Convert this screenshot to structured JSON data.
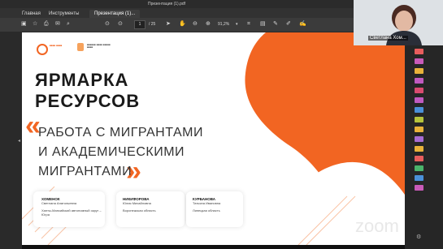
{
  "window": {
    "title": "Презентация (1).pdf"
  },
  "tabs": [
    {
      "label": "Главная"
    },
    {
      "label": "Инструменты"
    },
    {
      "label": "Презентация (1)..."
    }
  ],
  "toolbar": {
    "page_current": "1",
    "page_total": "/ 25",
    "zoom": "91,2%"
  },
  "participant": {
    "name": "Светлана Хом..."
  },
  "slide": {
    "title_line1": "ЯРМАРКА",
    "title_line2": "РЕСУРСОВ",
    "quote_open": "«",
    "quote_close": "»",
    "subtitle_line1": "РАБОТА С МИГРАНТАМИ",
    "subtitle_line2": "И АКАДЕМИЧЕСКИМИ",
    "subtitle_line3": "МИГРАНТАМИ",
    "people": [
      {
        "surname": "ХОМЕНОК",
        "name": "Светлана Анатольевна",
        "region": "Ханты-Мансийский автономный округ – Югра"
      },
      {
        "surname": "НИКИФОРОВА",
        "name": "Юлия Михайловна",
        "region": "Воронежская область"
      },
      {
        "surname": "КУРБАНОВА",
        "name": "Татьяна Ивановна",
        "region": "Липецкая область"
      }
    ]
  },
  "zoom_watermark": "zoom",
  "colors": {
    "accent": "#f26522",
    "chrome": "#3b3b3b"
  },
  "icons": [
    "home-icon",
    "star-icon",
    "save-icon",
    "print-icon",
    "mail-icon",
    "search-icon",
    "arrow-up-icon",
    "arrow-down-icon",
    "cursor-icon",
    "hand-icon",
    "zoom-out-icon",
    "zoom-in-icon",
    "crop-icon"
  ]
}
